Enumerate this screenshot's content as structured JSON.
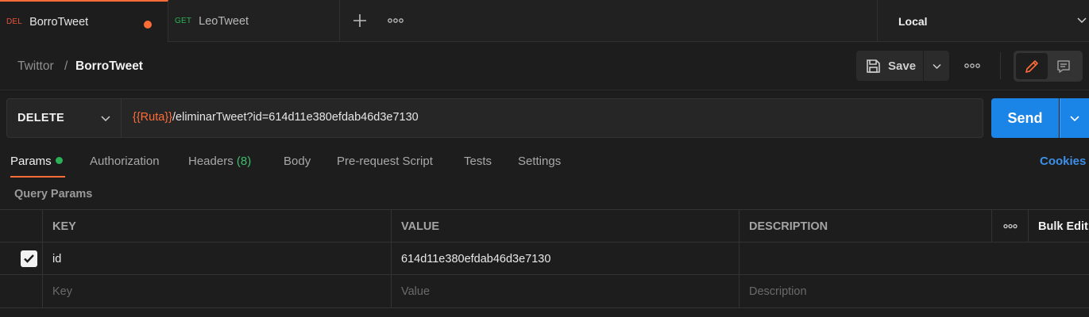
{
  "tabs": [
    {
      "method": "DEL",
      "method_color": "#e5533d",
      "name": "BorroTweet",
      "unsaved": true
    },
    {
      "method": "GET",
      "method_color": "#2bb155",
      "name": "LeoTweet"
    }
  ],
  "tab_actions": {
    "new_tab_icon": "plus-icon",
    "more_icon": "more-dots-icon"
  },
  "environment": {
    "label": "Local"
  },
  "breadcrumb": {
    "parent": "Twittor",
    "separator": "/",
    "current": "BorroTweet"
  },
  "toolbar": {
    "save_label": "Save"
  },
  "request": {
    "method": "DELETE",
    "url_variable": "{{Ruta}}",
    "url_rest": "/eliminarTweet?id=614d11e380efdab46d3e7130",
    "send_label": "Send"
  },
  "subtabs": {
    "params": "Params",
    "authorization": "Authorization",
    "headers": "Headers",
    "headers_count": "(8)",
    "body": "Body",
    "prerequest": "Pre-request Script",
    "tests": "Tests",
    "settings": "Settings",
    "cookies": "Cookies"
  },
  "query_params": {
    "title": "Query Params",
    "columns": {
      "key": "KEY",
      "value": "VALUE",
      "description": "DESCRIPTION",
      "bulk_edit": "Bulk Edit"
    },
    "rows": [
      {
        "checked": true,
        "key": "id",
        "value": "614d11e380efdab46d3e7130",
        "description": ""
      }
    ],
    "placeholders": {
      "key": "Key",
      "value": "Value",
      "description": "Description"
    }
  },
  "colors": {
    "accent": "#ff6c37",
    "send": "#1b84e7",
    "cookies_link": "#3d8fe8",
    "active_dot": "#2bb155"
  }
}
